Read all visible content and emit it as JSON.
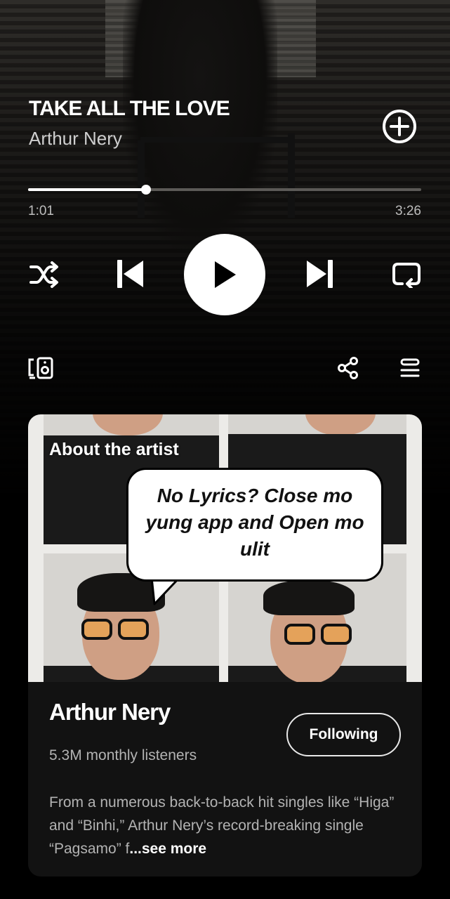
{
  "player": {
    "title": "TAKE ALL THE LOVE",
    "artist": "Arthur Nery",
    "elapsed": "1:01",
    "duration": "3:26",
    "progress_fraction": 0.3
  },
  "controls": {
    "shuffle_icon": "shuffle-icon",
    "previous_icon": "skip-previous-icon",
    "play_icon": "play-icon",
    "next_icon": "skip-next-icon",
    "repeat_icon": "repeat-icon",
    "devices_icon": "connect-devices-icon",
    "share_icon": "share-icon",
    "queue_icon": "queue-icon",
    "add_icon": "add-circle-icon"
  },
  "about": {
    "heading": "About the artist",
    "artist_name": "Arthur Nery",
    "listeners": "5.3M monthly listeners",
    "follow_label": "Following",
    "bio": "From a numerous back-to-back hit singles like “Higa” and “Binhi,” Arthur Nery’s record-breaking single “Pagsamo” f",
    "see_more": "...see more"
  },
  "overlay": {
    "bubble_text": "No Lyrics? Close mo yung app and Open mo ulit"
  },
  "colors": {
    "background": "#000000",
    "card": "#121212",
    "accent": "#ffffff"
  }
}
